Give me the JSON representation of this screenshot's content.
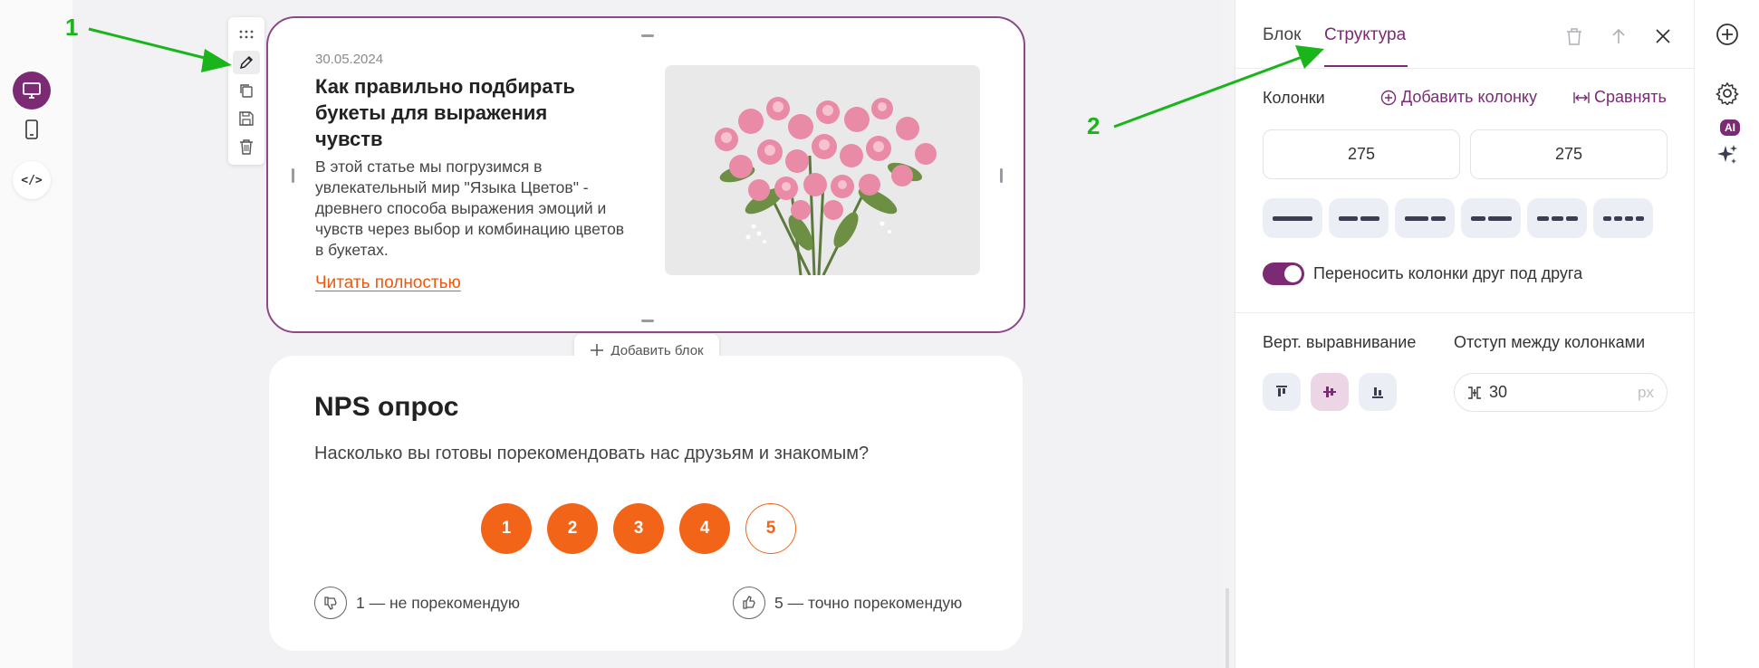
{
  "annotations": {
    "label_1": "1",
    "label_2": "2"
  },
  "colors": {
    "accent": "#7b2a73",
    "orange": "#f26418",
    "link": "#e85a13",
    "annotation": "#19b51a"
  },
  "left_toolbar": {
    "desktop_icon": "monitor-icon",
    "mobile_icon": "phone-icon",
    "code_icon": "code-icon",
    "code_label": "</>"
  },
  "block_toolbar": [
    "drag-icon",
    "pencil-icon",
    "copy-icon",
    "save-icon",
    "trash-icon"
  ],
  "article": {
    "date": "30.05.2024",
    "title": "Как правильно подбирать букеты для выражения чувств",
    "text": "В этой статье мы погрузимся в увлекательный мир \"Языка Цветов\" - древнего способа выражения эмоций и чувств через выбор и комбинацию цветов в букетах.",
    "link": "Читать полностью"
  },
  "add_block": {
    "label": "Добавить блок"
  },
  "nps": {
    "title": "NPS опрос",
    "question": "Насколько вы готовы порекомендовать нас друзьям и знакомым?",
    "scores": [
      "1",
      "2",
      "3",
      "4",
      "5"
    ],
    "selected_score": "5",
    "low_label": "1 — не порекомендую",
    "high_label": "5 — точно порекомендую"
  },
  "panel": {
    "tabs": {
      "block": "Блок",
      "structure": "Структура"
    },
    "active_tab": "Структура",
    "columns_label": "Колонки",
    "add_column": "Добавить колонку",
    "align_columns": "Сравнять",
    "col_widths": [
      "275",
      "275"
    ],
    "presets": [
      "1 column",
      "2 columns",
      "2 columns (wide left)",
      "2 columns (wide right)",
      "3 columns",
      "4 columns"
    ],
    "wrap_toggle_label": "Переносить колонки друг под друга",
    "wrap_toggle_on": true,
    "valign_label": "Верт. выравнивание",
    "valign_options": [
      "top",
      "center",
      "bottom"
    ],
    "valign_selected": "center",
    "gap_label": "Отступ между колонками",
    "gap_value": "30",
    "gap_unit": "px"
  },
  "right_rail": {
    "add_icon": "plus-circle-icon",
    "settings_icon": "gear-icon",
    "ai_badge": "AI",
    "ai_icon": "sparkle-icon"
  }
}
